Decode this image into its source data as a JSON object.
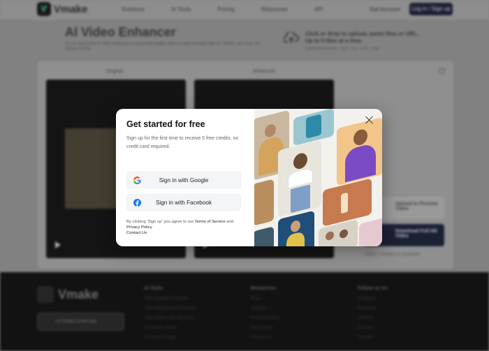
{
  "nav": {
    "brand": "Vmake",
    "links": [
      "Solutions",
      "AI Tools",
      "Pricing",
      "Resources",
      "API"
    ],
    "signin_label": "Get Account",
    "login_label": "Log in / Sign up"
  },
  "hero": {
    "title": "AI Video Enhancer",
    "description": "Try the best online AI video enhancer to convert low-quality videos to high resolution like 4K, 60FPS, and more. No signup needed.",
    "upload_text": "Click or drop to upload, paste files or URL. Up to 5 files at a time.",
    "upload_sub": "Supported formats: .mp4, .mov, .m4v, .mpg"
  },
  "workspace": {
    "original_label": "Original",
    "enhanced_label": "Enhanced",
    "preview_label": "Upload to Preview Video",
    "download_label": "Download Full HD Video",
    "note": "Costs 1 credit(s) to download"
  },
  "footer": {
    "brand": "Vmake",
    "badge": "#1 Product of the Day",
    "ai_tools_title": "AI Tools",
    "ai_tools": [
      "Video Quality Enhancer",
      "Video Background Remover",
      "Video Watermark Remover",
      "AI Fashion Model",
      "AI Product Image"
    ],
    "resources_title": "Resources",
    "resources": [
      "Blog",
      "Updates",
      "Customer Story",
      "Help Center",
      "Contact Us"
    ],
    "follow_title": "Follow us on",
    "follow": [
      "Instagram",
      "Facebook",
      "LinkedIn",
      "Discord",
      "Youtube"
    ]
  },
  "modal": {
    "title": "Get started for free",
    "subtitle": "Sign up for the first time to receive 5 free credits, no credit card required.",
    "google_label": "Sign in with Google",
    "facebook_label": "Sign in with Facebook",
    "terms_prefix": "By clicking 'Sign up' you agree to our ",
    "terms_link": "Terms of Service",
    "terms_and": " and",
    "privacy_link": "Privacy Policy",
    "contact_link": "Contact Us"
  },
  "colors": {
    "google_blue": "#4285F4",
    "facebook_blue": "#1877F2",
    "dark_button": "#1d2438",
    "footer_bg": "#141414"
  }
}
